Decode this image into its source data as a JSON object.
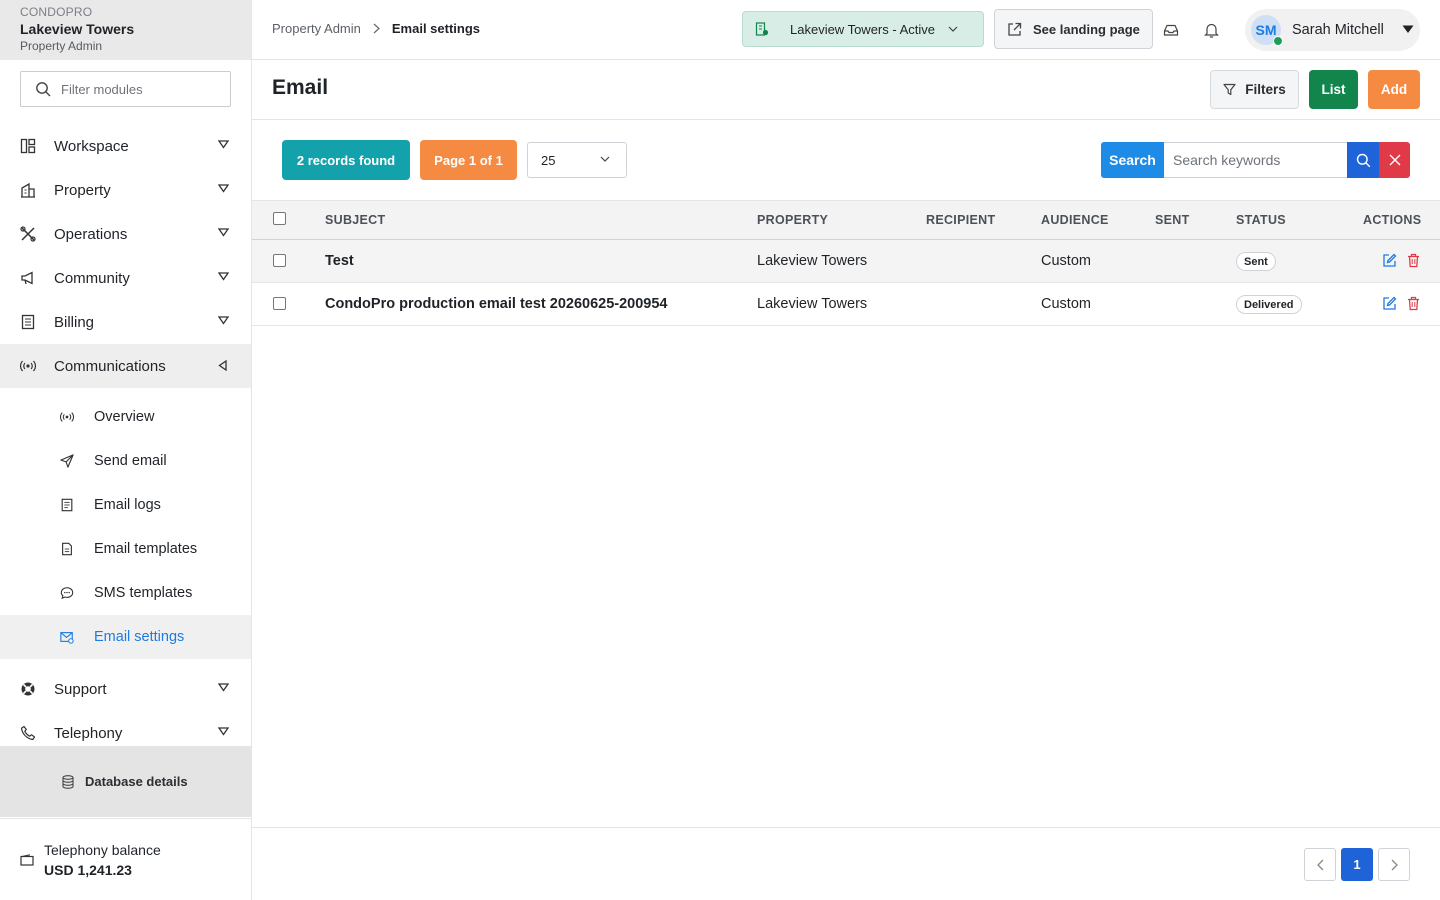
{
  "brand": {
    "app_name": "CONDOPRO",
    "property_name": "Lakeview Towers",
    "role": "Property Admin"
  },
  "sidebar": {
    "filter_placeholder": "Filter modules",
    "items": [
      {
        "label": "Workspace",
        "icon": "workspace-icon"
      },
      {
        "label": "Property",
        "icon": "building-icon"
      },
      {
        "label": "Operations",
        "icon": "tools-icon"
      },
      {
        "label": "Community",
        "icon": "megaphone-icon"
      },
      {
        "label": "Billing",
        "icon": "billing-icon"
      },
      {
        "label": "Communications",
        "icon": "broadcast-icon",
        "expanded": true
      }
    ],
    "sub_items": [
      {
        "label": "Overview",
        "icon": "broadcast-icon"
      },
      {
        "label": "Send email",
        "icon": "send-icon"
      },
      {
        "label": "Email logs",
        "icon": "log-icon"
      },
      {
        "label": "Email templates",
        "icon": "template-icon"
      },
      {
        "label": "SMS templates",
        "icon": "chat-icon"
      },
      {
        "label": "Email settings",
        "icon": "email-settings-icon",
        "active": true
      }
    ],
    "after_items": [
      {
        "label": "Support",
        "icon": "lifebuoy-icon"
      },
      {
        "label": "Telephony",
        "icon": "phone-icon"
      }
    ],
    "database_details": "Database details",
    "balance_label": "Telephony balance",
    "balance_value": "USD 1,241.23"
  },
  "topbar": {
    "breadcrumb_parent": "Property Admin",
    "breadcrumb_current": "Email settings",
    "property_selector": "Lakeview Towers - Active",
    "landing_button": "See landing page",
    "user_initials": "SM",
    "user_name": "Sarah Mitchell"
  },
  "page": {
    "title": "Email",
    "filters_label": "Filters",
    "list_label": "List",
    "add_label": "Add"
  },
  "toolbar": {
    "records_found": "2 records found",
    "page_info": "Page 1 of 1",
    "per_page": "25",
    "search_label": "Search",
    "search_placeholder": "Search keywords"
  },
  "table": {
    "columns": [
      "SUBJECT",
      "PROPERTY",
      "RECIPIENT",
      "AUDIENCE",
      "SENT",
      "STATUS",
      "ACTIONS"
    ],
    "rows": [
      {
        "subject": "Test",
        "property": "Lakeview Towers",
        "recipient": "",
        "audience": "Custom",
        "sent": "",
        "status": "Sent"
      },
      {
        "subject": "CondoPro production email test 20260625-200954",
        "property": "Lakeview Towers",
        "recipient": "",
        "audience": "Custom",
        "sent": "",
        "status": "Delivered"
      }
    ]
  },
  "pagination": {
    "current_page": "1"
  },
  "colors": {
    "accent_blue": "#1f63d8",
    "success_green": "#12854c",
    "orange": "#f58a42",
    "teal": "#13a2ac",
    "danger_red": "#e03a48"
  }
}
